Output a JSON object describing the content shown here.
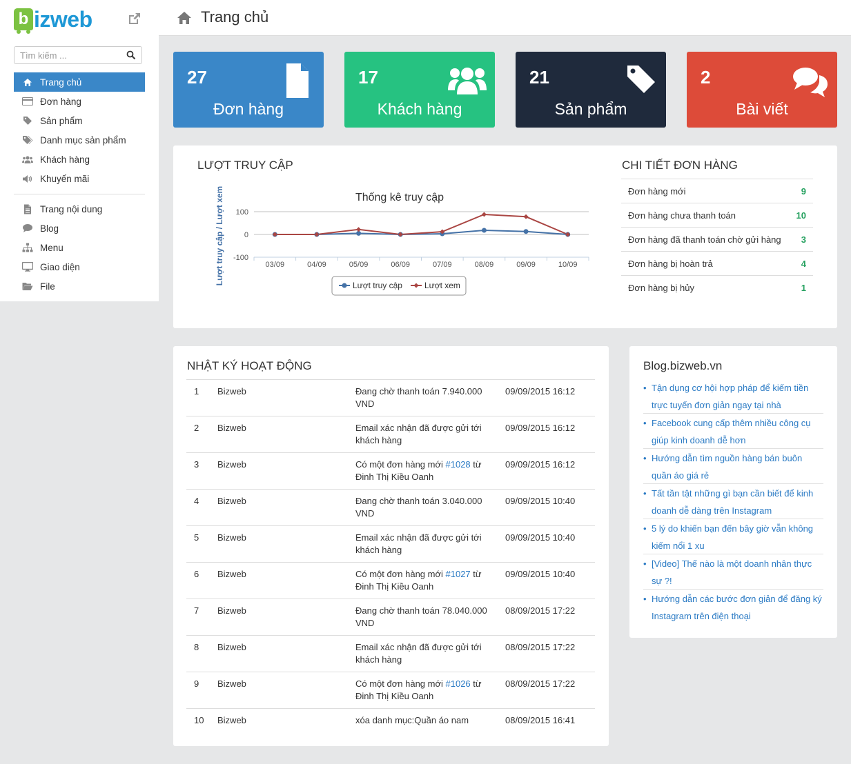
{
  "brand": {
    "logo_letter": "b",
    "logo_text": "izweb"
  },
  "search": {
    "placeholder": "Tìm kiếm ..."
  },
  "sidebar": {
    "group1": [
      {
        "label": "Trang chủ",
        "icon": "home-icon",
        "active": true
      },
      {
        "label": "Đơn hàng",
        "icon": "credit-card-icon"
      },
      {
        "label": "Sản phẩm",
        "icon": "tag-icon"
      },
      {
        "label": "Danh mục sản phẩm",
        "icon": "tags-icon"
      },
      {
        "label": "Khách hàng",
        "icon": "users-icon"
      },
      {
        "label": "Khuyến mãi",
        "icon": "volume-icon"
      }
    ],
    "group2": [
      {
        "label": "Trang nội dung",
        "icon": "file-icon"
      },
      {
        "label": "Blog",
        "icon": "comment-icon"
      },
      {
        "label": "Menu",
        "icon": "sitemap-icon"
      },
      {
        "label": "Giao diện",
        "icon": "desktop-icon"
      },
      {
        "label": "File",
        "icon": "folder-open-icon"
      }
    ]
  },
  "header": {
    "title": "Trang chủ"
  },
  "stats": [
    {
      "value": "27",
      "label": "Đơn hàng",
      "icon": "file-icon",
      "color": "#3a87c8"
    },
    {
      "value": "17",
      "label": "Khách hàng",
      "icon": "users-icon",
      "color": "#26c281"
    },
    {
      "value": "21",
      "label": "Sản phẩm",
      "icon": "tag-icon",
      "color": "#1f2a3c"
    },
    {
      "value": "2",
      "label": "Bài viết",
      "icon": "comments-icon",
      "color": "#dd4b39"
    }
  ],
  "visits_panel": {
    "title": "LƯỢT TRUY CẬP"
  },
  "chart_data": {
    "type": "line",
    "title": "Thống kê truy cập",
    "ylabel": "Lượt truy cập / Lượt xem",
    "xlabel": "",
    "categories": [
      "03/09",
      "04/09",
      "05/09",
      "06/09",
      "07/09",
      "08/09",
      "09/09",
      "10/09"
    ],
    "yticks": [
      "100",
      "0",
      "-100"
    ],
    "ylim": [
      -100,
      100
    ],
    "series": [
      {
        "name": "Lượt truy cập",
        "color": "#4572a7",
        "values": [
          0,
          0,
          5,
          0,
          3,
          18,
          13,
          0
        ]
      },
      {
        "name": "Lượt xem",
        "color": "#aa4643",
        "values": [
          0,
          0,
          22,
          0,
          12,
          88,
          78,
          0
        ]
      }
    ],
    "legend": "bottom-center"
  },
  "order_details": {
    "title": "CHI TIẾT ĐƠN HÀNG",
    "rows": [
      {
        "label": "Đơn hàng mới",
        "value": "9"
      },
      {
        "label": "Đơn hàng chưa thanh toán",
        "value": "10"
      },
      {
        "label": "Đơn hàng đã thanh toán chờ gửi hàng",
        "value": "3"
      },
      {
        "label": "Đơn hàng bị hoàn trả",
        "value": "4"
      },
      {
        "label": "Đơn hàng bị hủy",
        "value": "1"
      }
    ]
  },
  "activity": {
    "title": "NHẬT KÝ HOẠT ĐỘNG",
    "rows": [
      {
        "n": "1",
        "user": "Bizweb",
        "pre": "Đang chờ thanh toán 7.940.000 VND",
        "link": "",
        "post": "",
        "time": "09/09/2015 16:12"
      },
      {
        "n": "2",
        "user": "Bizweb",
        "pre": "Email xác nhận đã được gửi tới khách hàng",
        "link": "",
        "post": "",
        "time": "09/09/2015 16:12"
      },
      {
        "n": "3",
        "user": "Bizweb",
        "pre": "Có một đơn hàng mới ",
        "link": "#1028",
        "post": " từ Đinh Thị Kiều Oanh",
        "time": "09/09/2015 16:12"
      },
      {
        "n": "4",
        "user": "Bizweb",
        "pre": "Đang chờ thanh toán 3.040.000 VND",
        "link": "",
        "post": "",
        "time": "09/09/2015 10:40"
      },
      {
        "n": "5",
        "user": "Bizweb",
        "pre": "Email xác nhận đã được gửi tới khách hàng",
        "link": "",
        "post": "",
        "time": "09/09/2015 10:40"
      },
      {
        "n": "6",
        "user": "Bizweb",
        "pre": "Có một đơn hàng mới ",
        "link": "#1027",
        "post": " từ Đinh Thị Kiều Oanh",
        "time": "09/09/2015 10:40"
      },
      {
        "n": "7",
        "user": "Bizweb",
        "pre": "Đang chờ thanh toán 78.040.000 VND",
        "link": "",
        "post": "",
        "time": "08/09/2015 17:22"
      },
      {
        "n": "8",
        "user": "Bizweb",
        "pre": "Email xác nhận đã được gửi tới khách hàng",
        "link": "",
        "post": "",
        "time": "08/09/2015 17:22"
      },
      {
        "n": "9",
        "user": "Bizweb",
        "pre": "Có một đơn hàng mới ",
        "link": "#1026",
        "post": " từ Đinh Thị Kiều Oanh",
        "time": "08/09/2015 17:22"
      },
      {
        "n": "10",
        "user": "Bizweb",
        "pre": "xóa danh mục:Quần áo nam",
        "link": "",
        "post": "",
        "time": "08/09/2015 16:41"
      }
    ]
  },
  "blog": {
    "title": "Blog.bizweb.vn",
    "items": [
      "Tận dụng cơ hội hợp pháp để kiếm tiền trực tuyến đơn giản ngay tại nhà",
      "Facebook cung cấp thêm nhiều công cụ giúp kinh doanh dễ hơn",
      "Hướng dẫn tìm nguồn hàng bán buôn quần áo giá rẻ",
      "Tất tần tật những gì bạn cần biết để kinh doanh dễ dàng trên Instagram",
      "5 lý do khiến bạn đến bây giờ vẫn không kiếm nổi 1 xu",
      "[Video] Thế nào là một doanh nhân thực sự ?!",
      "Hướng dẫn các bước đơn giản để đăng ký Instagram trên điện thoại"
    ]
  }
}
